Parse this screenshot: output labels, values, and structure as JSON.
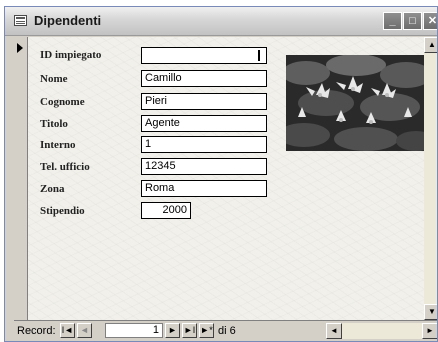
{
  "window": {
    "title": "Dipendenti",
    "icon": "table-form-icon",
    "minimize_glyph": "_",
    "maximize_glyph": "□",
    "close_glyph": "✕"
  },
  "form": {
    "fields": [
      {
        "label": "ID impiegato",
        "value": ""
      },
      {
        "label": "Nome",
        "value": "Camillo"
      },
      {
        "label": "Cognome",
        "value": "Pieri"
      },
      {
        "label": "Titolo",
        "value": "Agente"
      },
      {
        "label": "Interno",
        "value": "1"
      },
      {
        "label": "Tel. ufficio",
        "value": "12345"
      },
      {
        "label": "Zona",
        "value": "Roma"
      },
      {
        "label": "Stipendio",
        "value": "2000"
      }
    ],
    "photo": "water-lilies-photo"
  },
  "navigation": {
    "record_label": "Record:",
    "first_glyph": "I◄",
    "prev_glyph": "◄",
    "current_record": "1",
    "next_glyph": "►",
    "last_glyph": "►I",
    "new_glyph": "►*",
    "of_text": "di 6"
  },
  "scroll": {
    "up_glyph": "▲",
    "down_glyph": "▼",
    "left_glyph": "◄",
    "right_glyph": "►"
  }
}
